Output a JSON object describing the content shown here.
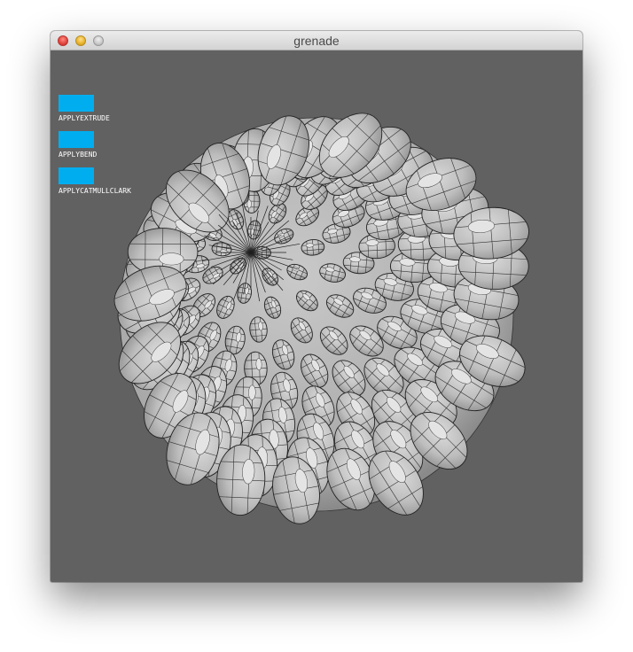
{
  "window": {
    "title": "grenade"
  },
  "controls": [
    {
      "label": "APPLYEXTRUDE"
    },
    {
      "label": "APPLYBEND"
    },
    {
      "label": "APPLYCATMULLCLARK"
    }
  ],
  "colors": {
    "background": "#616161",
    "button": "#00aeef",
    "mesh_fill": "#bfbfbf",
    "mesh_stroke": "#222222"
  },
  "icons": {
    "close": "close-icon",
    "minimize": "minimize-icon",
    "zoom": "zoom-icon"
  }
}
